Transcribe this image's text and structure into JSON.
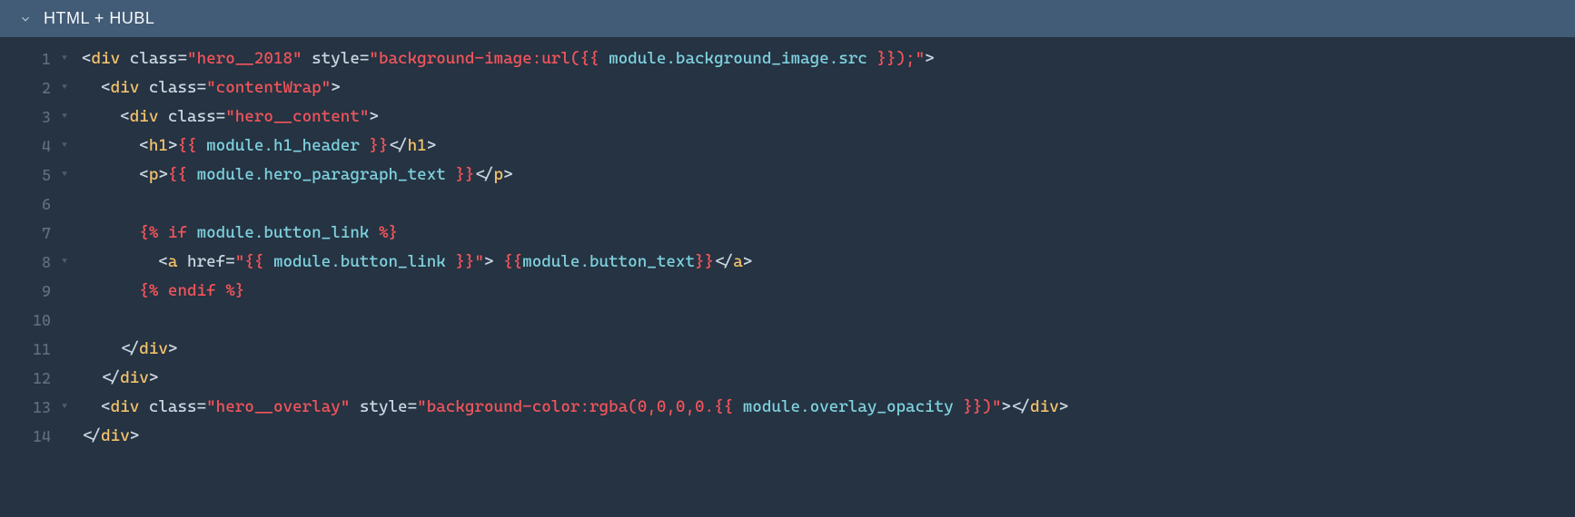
{
  "header": {
    "title": "HTML + HUBL"
  },
  "gutter": {
    "lines": [
      {
        "num": "1",
        "fold": true
      },
      {
        "num": "2",
        "fold": true
      },
      {
        "num": "3",
        "fold": true
      },
      {
        "num": "4",
        "fold": true
      },
      {
        "num": "5",
        "fold": true
      },
      {
        "num": "6",
        "fold": false
      },
      {
        "num": "7",
        "fold": false
      },
      {
        "num": "8",
        "fold": true
      },
      {
        "num": "9",
        "fold": false
      },
      {
        "num": "10",
        "fold": false
      },
      {
        "num": "11",
        "fold": false
      },
      {
        "num": "12",
        "fold": false
      },
      {
        "num": "13",
        "fold": true
      },
      {
        "num": "14",
        "fold": false
      }
    ]
  },
  "code": {
    "l1": {
      "tag": "div",
      "attr_class": "class",
      "val_class": "\"hero__2018\"",
      "attr_style": "style",
      "val_style_a": "\"background-image:url(",
      "hubl_open": "{{",
      "hubl_var": "module.background_image.src",
      "hubl_close": "}}",
      "val_style_b": ");\""
    },
    "l2": {
      "tag": "div",
      "attr_class": "class",
      "val_class": "\"contentWrap\""
    },
    "l3": {
      "tag": "div",
      "attr_class": "class",
      "val_class": "\"hero__content\""
    },
    "l4": {
      "tag_open": "h1",
      "hubl_open": "{{",
      "hubl_var": "module.h1_header",
      "hubl_close": "}}",
      "tag_close": "h1"
    },
    "l5": {
      "tag_open": "p",
      "hubl_open": "{{",
      "hubl_var": "module.hero_paragraph_text",
      "hubl_close": "}}",
      "tag_close": "p"
    },
    "l7": {
      "delim_open": "{%",
      "kw_if": "if",
      "var": "module.button_link",
      "delim_close": "%}"
    },
    "l8": {
      "tag": "a",
      "attr_href": "href",
      "val_href_a": "\"",
      "hubl_open": "{{",
      "hubl_var": "module.button_link",
      "hubl_close": "}}",
      "val_href_b": "\"",
      "hubl_open2": "{{",
      "hubl_var2": "module.button_text",
      "hubl_close2": "}}",
      "tag_close": "a"
    },
    "l9": {
      "delim_open": "{%",
      "kw_endif": "endif",
      "delim_close": "%}"
    },
    "l11": {
      "tag": "div"
    },
    "l12": {
      "tag": "div"
    },
    "l13": {
      "tag": "div",
      "attr_class": "class",
      "val_class": "\"hero__overlay\"",
      "attr_style": "style",
      "val_style_a": "\"background-color:rgba(0,0,0,0.",
      "hubl_open": "{{",
      "hubl_var": "module.overlay_opacity",
      "hubl_close": "}}",
      "val_style_b": ")\"",
      "tag_close": "div"
    },
    "l14": {
      "tag": "div"
    }
  }
}
